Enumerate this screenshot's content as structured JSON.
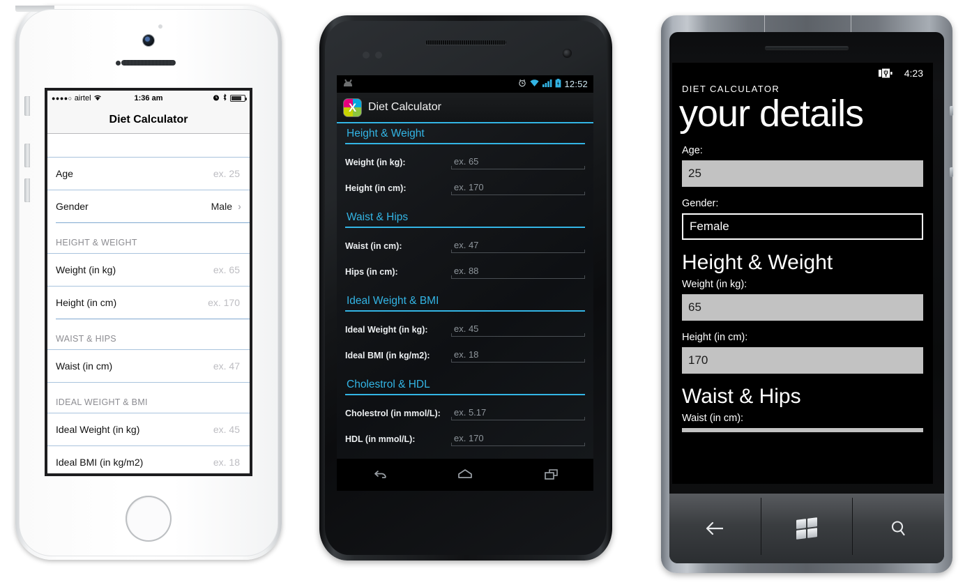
{
  "iphone": {
    "status": {
      "signal_dots": "●●●●○",
      "carrier": "airtel",
      "wifi_icon": "wifi-icon",
      "time": "1:36 am",
      "alarm_icon": "alarm-icon",
      "bluetooth_icon": "bluetooth-icon",
      "battery_icon": "battery-icon"
    },
    "navbar_title": "Diet Calculator",
    "rows": [
      {
        "type": "row",
        "label": "Age",
        "placeholder": "ex. 25"
      },
      {
        "type": "row-val",
        "label": "Gender",
        "value": "Male",
        "chevron": "chevron-right-icon"
      },
      {
        "type": "header",
        "label": "HEIGHT & WEIGHT"
      },
      {
        "type": "row",
        "label": "Weight (in kg)",
        "placeholder": "ex. 65"
      },
      {
        "type": "row",
        "label": "Height (in cm)",
        "placeholder": "ex. 170"
      },
      {
        "type": "header",
        "label": "WAIST & HIPS"
      },
      {
        "type": "row",
        "label": "Waist (in cm)",
        "placeholder": "ex. 47"
      },
      {
        "type": "header",
        "label": "IDEAL WEIGHT & BMI"
      },
      {
        "type": "row",
        "label": "Ideal Weight (in kg)",
        "placeholder": "ex. 45"
      },
      {
        "type": "row",
        "label": "Ideal BMI (in kg/m2)",
        "placeholder": "ex. 18"
      }
    ]
  },
  "android": {
    "status": {
      "droid_icon": "android-robot-icon",
      "alarm_icon": "alarm-icon",
      "wifi_icon": "wifi-icon",
      "signal_icon": "signal-bars-icon",
      "battery_icon": "battery-charging-icon",
      "time": "12:52"
    },
    "app_icon": "app-logo-x-icon",
    "app_icon_glyph": "X",
    "app_title": "Diet Calculator",
    "accent": "#33b5e5",
    "sections": [
      {
        "title": "Height & Weight",
        "fields": [
          {
            "label": "Weight (in kg):",
            "placeholder": "ex. 65"
          },
          {
            "label": "Height (in cm):",
            "placeholder": "ex. 170"
          }
        ]
      },
      {
        "title": "Waist & Hips",
        "fields": [
          {
            "label": "Waist (in cm):",
            "placeholder": "ex. 47"
          },
          {
            "label": "Hips (in cm):",
            "placeholder": "ex. 88"
          }
        ]
      },
      {
        "title": "Ideal Weight & BMI",
        "fields": [
          {
            "label": "Ideal Weight (in kg):",
            "placeholder": "ex. 45"
          },
          {
            "label": "Ideal BMI (in kg/m2):",
            "placeholder": "ex. 18"
          }
        ]
      },
      {
        "title": "Cholestrol & HDL",
        "fields": [
          {
            "label": "Cholestrol (in mmol/L):",
            "placeholder": "ex. 5.17"
          },
          {
            "label": "HDL (in mmol/L):",
            "placeholder": "ex. 170"
          }
        ]
      }
    ],
    "navbar": {
      "back": "back-icon",
      "home": "home-icon",
      "recents": "recent-apps-icon"
    }
  },
  "winphone": {
    "status": {
      "battery_icon": "battery-charging-icon",
      "time": "4:23"
    },
    "app_title": "DIET CALCULATOR",
    "page_title": "your details",
    "fields": [
      {
        "label": "Age:",
        "value": "25",
        "state": "filled"
      },
      {
        "label": "Gender:",
        "value": "Female",
        "state": "focused"
      }
    ],
    "sections": [
      {
        "title": "Height & Weight",
        "fields": [
          {
            "label": "Weight (in kg):",
            "value": "65",
            "state": "filled"
          },
          {
            "label": "Height (in cm):",
            "value": "170",
            "state": "filled"
          }
        ]
      },
      {
        "title": "Waist & Hips",
        "fields": [
          {
            "label": "Waist (in cm):",
            "value": "",
            "state": "clipped"
          }
        ]
      }
    ],
    "navbar": {
      "back": "back-arrow-icon",
      "start": "windows-logo-icon",
      "search": "search-icon"
    }
  }
}
